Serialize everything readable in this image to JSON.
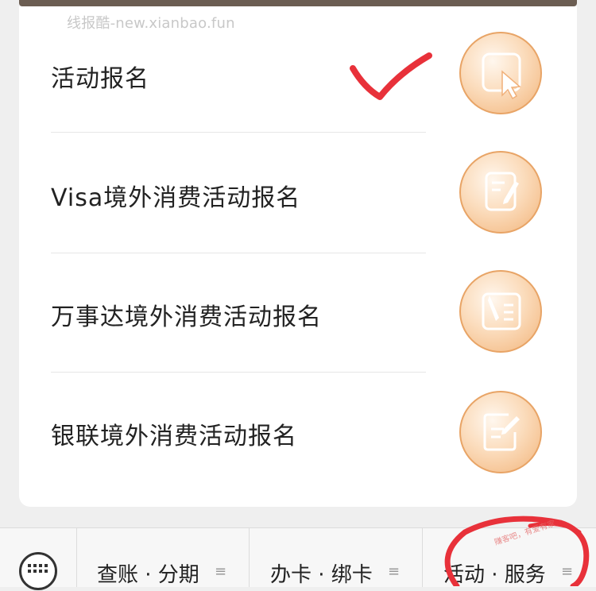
{
  "watermark": "线报酷-new.xianbao.fun",
  "menu_items": [
    {
      "label": "活动报名",
      "icon": "cursor-select-icon"
    },
    {
      "label": "Visa境外消费活动报名",
      "icon": "edit-document-icon"
    },
    {
      "label": "万事达境外消费活动报名",
      "icon": "brush-list-icon"
    },
    {
      "label": "银联境外消费活动报名",
      "icon": "edit-square-icon"
    }
  ],
  "bottom_tabs": [
    {
      "label": "查账 · 分期",
      "menu_glyph": "≡"
    },
    {
      "label": "办卡 · 绑卡",
      "menu_glyph": "≡"
    },
    {
      "label": "活动 · 服务",
      "menu_glyph": "≡"
    }
  ],
  "keyboard_icon": "keyboard-icon",
  "sticker_text": "赚客吧，有爱有家",
  "colors": {
    "icon_ring": "#e8a466",
    "annotation_red": "#e8313a",
    "card_bg": "#ffffff",
    "page_bg": "#efefef"
  }
}
